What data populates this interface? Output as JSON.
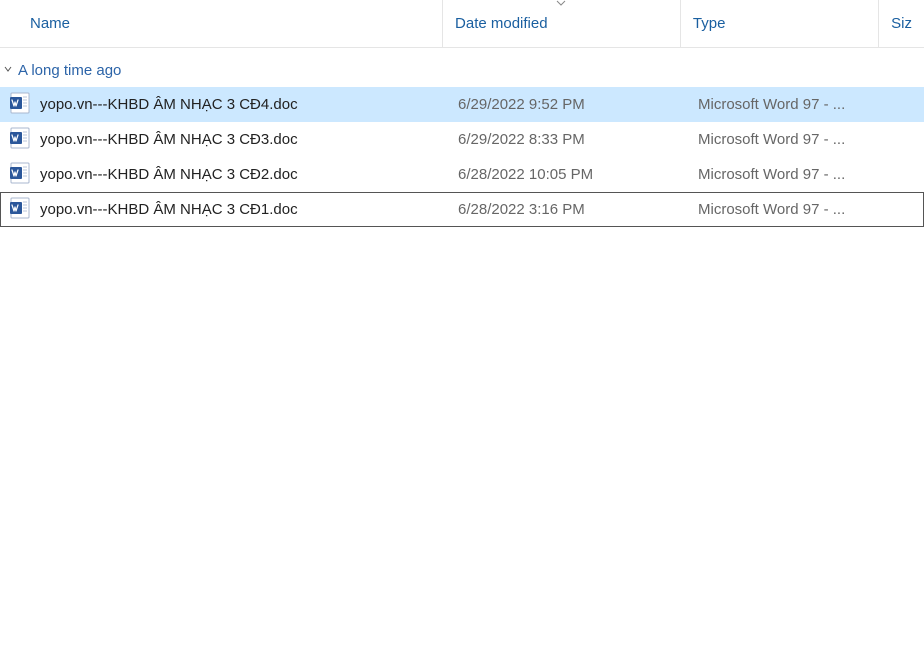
{
  "columns": {
    "name": "Name",
    "date": "Date modified",
    "type": "Type",
    "size": "Siz"
  },
  "group": {
    "label": "A long time ago"
  },
  "files": [
    {
      "name": "yopo.vn---KHBD ÂM NHẠC 3 CĐ4.doc",
      "date": "6/29/2022 9:52 PM",
      "type": "Microsoft Word 97 - ...",
      "selected": true,
      "focused": false
    },
    {
      "name": "yopo.vn---KHBD ÂM NHẠC 3 CĐ3.doc",
      "date": "6/29/2022 8:33 PM",
      "type": "Microsoft Word 97 - ...",
      "selected": false,
      "focused": false
    },
    {
      "name": "yopo.vn---KHBD ÂM NHẠC 3 CĐ2.doc",
      "date": "6/28/2022 10:05 PM",
      "type": "Microsoft Word 97 - ...",
      "selected": false,
      "focused": false
    },
    {
      "name": "yopo.vn---KHBD ÂM NHẠC 3 CĐ1.doc",
      "date": "6/28/2022 3:16 PM",
      "type": "Microsoft Word 97 - ...",
      "selected": false,
      "focused": true
    }
  ]
}
